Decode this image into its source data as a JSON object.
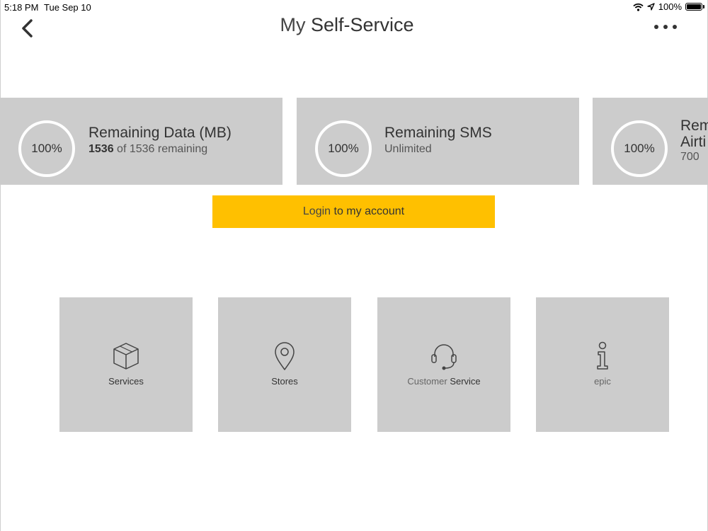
{
  "status_bar": {
    "time": "5:18 PM",
    "date": "Tue Sep 10",
    "battery": "100%"
  },
  "header": {
    "title_prefix": "My",
    "title_bold": "Self-Service"
  },
  "cards": [
    {
      "percent": "100%",
      "title": "Remaining Data (MB)",
      "sub_number": "1536",
      "sub_text": "of 1536 remaining"
    },
    {
      "percent": "100%",
      "title": "Remaining SMS",
      "sub_text": "Unlimited"
    },
    {
      "percent": "100%",
      "title_line1": "Rem",
      "title_line2": "Airti",
      "sub_text": "700"
    }
  ],
  "login": {
    "label_light": "Login",
    "label_strong": "to my account"
  },
  "tiles": [
    {
      "label": "Services",
      "icon": "box-icon"
    },
    {
      "label": "Stores",
      "icon": "location-pin-icon"
    },
    {
      "label_light": "Customer",
      "label_strong": "Service",
      "icon": "headset-icon"
    },
    {
      "label": "epic",
      "icon": "info-icon"
    }
  ],
  "colors": {
    "card_bg": "#cccccc",
    "accent": "#ffc000"
  }
}
